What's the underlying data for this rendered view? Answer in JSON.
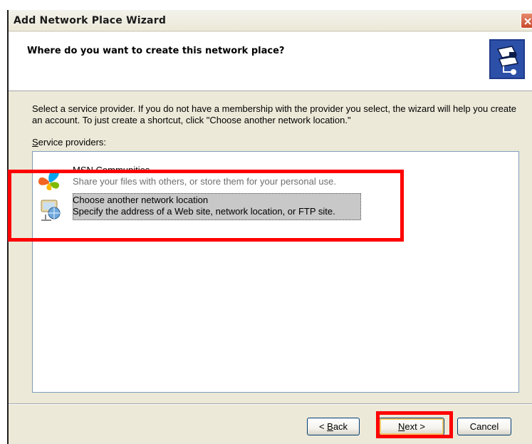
{
  "window": {
    "title": "Add Network Place Wizard"
  },
  "header": {
    "title": "Where do you want to create this network place?",
    "icon": "network-place-wizard-icon"
  },
  "body": {
    "description": "Select a service provider.  If you do not have a membership with the provider you select, the wizard will help you create an account.  To just create a shortcut, click \"Choose another network location.\"",
    "list_label_accel": "S",
    "list_label_rest": "ervice providers:"
  },
  "providers": [
    {
      "title": "MSN Communities",
      "description": "Share your files with others, or store them for your personal use.",
      "icon": "msn-butterfly-icon",
      "selected": false
    },
    {
      "title": "Choose another network location",
      "description": "Specify the address of a Web site, network location, or FTP site.",
      "icon": "network-location-icon",
      "selected": true
    }
  ],
  "buttons": {
    "back_prefix": "< ",
    "back_accel": "B",
    "back_rest": "ack",
    "next_accel": "N",
    "next_rest": "ext >",
    "cancel": "Cancel"
  },
  "colors": {
    "dialog_bg": "#ece9d8",
    "highlight": "#ff0000",
    "selection": "#c8c8c8"
  }
}
